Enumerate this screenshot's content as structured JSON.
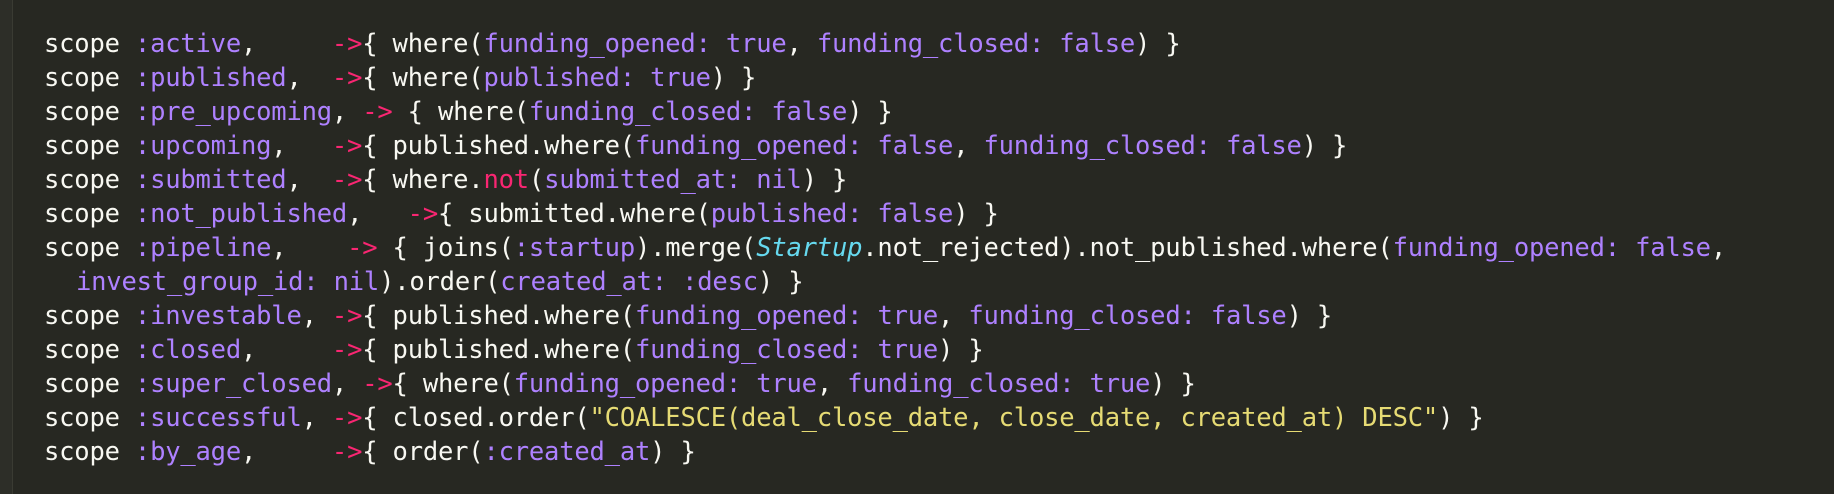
{
  "editor": {
    "colors": {
      "background": "#272822",
      "plain": "#f8f8f2",
      "symbol": "#ae81ff",
      "arrow": "#f92672",
      "class": "#66d9ef",
      "string": "#e6db74"
    },
    "lines": [
      [
        {
          "t": "kw",
          "v": "scope "
        },
        {
          "t": "sym",
          "v": ":active"
        },
        {
          "t": "pl",
          "v": ",     "
        },
        {
          "t": "arr",
          "v": "->"
        },
        {
          "t": "pl",
          "v": "{ where("
        },
        {
          "t": "key",
          "v": "funding_opened:"
        },
        {
          "t": "pl",
          "v": " "
        },
        {
          "t": "bool",
          "v": "true"
        },
        {
          "t": "pl",
          "v": ", "
        },
        {
          "t": "key",
          "v": "funding_closed:"
        },
        {
          "t": "pl",
          "v": " "
        },
        {
          "t": "bool",
          "v": "false"
        },
        {
          "t": "pl",
          "v": ") }"
        }
      ],
      [
        {
          "t": "kw",
          "v": "scope "
        },
        {
          "t": "sym",
          "v": ":published"
        },
        {
          "t": "pl",
          "v": ",  "
        },
        {
          "t": "arr",
          "v": "->"
        },
        {
          "t": "pl",
          "v": "{ where("
        },
        {
          "t": "key",
          "v": "published:"
        },
        {
          "t": "pl",
          "v": " "
        },
        {
          "t": "bool",
          "v": "true"
        },
        {
          "t": "pl",
          "v": ") }"
        }
      ],
      [
        {
          "t": "kw",
          "v": "scope "
        },
        {
          "t": "sym",
          "v": ":pre_upcoming"
        },
        {
          "t": "pl",
          "v": ", "
        },
        {
          "t": "arr",
          "v": "->"
        },
        {
          "t": "pl",
          "v": " { where("
        },
        {
          "t": "key",
          "v": "funding_closed:"
        },
        {
          "t": "pl",
          "v": " "
        },
        {
          "t": "bool",
          "v": "false"
        },
        {
          "t": "pl",
          "v": ") }"
        }
      ],
      [
        {
          "t": "kw",
          "v": "scope "
        },
        {
          "t": "sym",
          "v": ":upcoming"
        },
        {
          "t": "pl",
          "v": ",   "
        },
        {
          "t": "arr",
          "v": "->"
        },
        {
          "t": "pl",
          "v": "{ published.where("
        },
        {
          "t": "key",
          "v": "funding_opened:"
        },
        {
          "t": "pl",
          "v": " "
        },
        {
          "t": "bool",
          "v": "false"
        },
        {
          "t": "pl",
          "v": ", "
        },
        {
          "t": "key",
          "v": "funding_closed:"
        },
        {
          "t": "pl",
          "v": " "
        },
        {
          "t": "bool",
          "v": "false"
        },
        {
          "t": "pl",
          "v": ") }"
        }
      ],
      [
        {
          "t": "kw",
          "v": "scope "
        },
        {
          "t": "sym",
          "v": ":submitted"
        },
        {
          "t": "pl",
          "v": ",  "
        },
        {
          "t": "arr",
          "v": "->"
        },
        {
          "t": "pl",
          "v": "{ where."
        },
        {
          "t": "not",
          "v": "not"
        },
        {
          "t": "pl",
          "v": "("
        },
        {
          "t": "key",
          "v": "submitted_at:"
        },
        {
          "t": "pl",
          "v": " "
        },
        {
          "t": "bool",
          "v": "nil"
        },
        {
          "t": "pl",
          "v": ") }"
        }
      ],
      [
        {
          "t": "kw",
          "v": "scope "
        },
        {
          "t": "sym",
          "v": ":not_published"
        },
        {
          "t": "pl",
          "v": ",   "
        },
        {
          "t": "arr",
          "v": "->"
        },
        {
          "t": "pl",
          "v": "{ submitted.where("
        },
        {
          "t": "key",
          "v": "published:"
        },
        {
          "t": "pl",
          "v": " "
        },
        {
          "t": "bool",
          "v": "false"
        },
        {
          "t": "pl",
          "v": ") }"
        }
      ],
      [
        {
          "t": "kw",
          "v": "scope "
        },
        {
          "t": "sym",
          "v": ":pipeline"
        },
        {
          "t": "pl",
          "v": ",    "
        },
        {
          "t": "arr",
          "v": "->"
        },
        {
          "t": "pl",
          "v": " { joins("
        },
        {
          "t": "sym",
          "v": ":startup"
        },
        {
          "t": "pl",
          "v": ").merge("
        },
        {
          "t": "cls",
          "v": "Startup"
        },
        {
          "t": "pl",
          "v": ".not_rejected).not_published.where("
        },
        {
          "t": "key",
          "v": "funding_opened:"
        },
        {
          "t": "pl",
          "v": " "
        },
        {
          "t": "bool",
          "v": "false"
        },
        {
          "t": "pl",
          "v": ","
        }
      ],
      [
        {
          "t": "key",
          "v": "invest_group_id:"
        },
        {
          "t": "pl",
          "v": " "
        },
        {
          "t": "bool",
          "v": "nil"
        },
        {
          "t": "pl",
          "v": ").order("
        },
        {
          "t": "key",
          "v": "created_at:"
        },
        {
          "t": "pl",
          "v": " "
        },
        {
          "t": "sym",
          "v": ":desc"
        },
        {
          "t": "pl",
          "v": ") }"
        }
      ],
      [
        {
          "t": "kw",
          "v": "scope "
        },
        {
          "t": "sym",
          "v": ":investable"
        },
        {
          "t": "pl",
          "v": ", "
        },
        {
          "t": "arr",
          "v": "->"
        },
        {
          "t": "pl",
          "v": "{ published.where("
        },
        {
          "t": "key",
          "v": "funding_opened:"
        },
        {
          "t": "pl",
          "v": " "
        },
        {
          "t": "bool",
          "v": "true"
        },
        {
          "t": "pl",
          "v": ", "
        },
        {
          "t": "key",
          "v": "funding_closed:"
        },
        {
          "t": "pl",
          "v": " "
        },
        {
          "t": "bool",
          "v": "false"
        },
        {
          "t": "pl",
          "v": ") }"
        }
      ],
      [
        {
          "t": "kw",
          "v": "scope "
        },
        {
          "t": "sym",
          "v": ":closed"
        },
        {
          "t": "pl",
          "v": ",     "
        },
        {
          "t": "arr",
          "v": "->"
        },
        {
          "t": "pl",
          "v": "{ published.where("
        },
        {
          "t": "key",
          "v": "funding_closed:"
        },
        {
          "t": "pl",
          "v": " "
        },
        {
          "t": "bool",
          "v": "true"
        },
        {
          "t": "pl",
          "v": ") }"
        }
      ],
      [
        {
          "t": "kw",
          "v": "scope "
        },
        {
          "t": "sym",
          "v": ":super_closed"
        },
        {
          "t": "pl",
          "v": ", "
        },
        {
          "t": "arr",
          "v": "->"
        },
        {
          "t": "pl",
          "v": "{ where("
        },
        {
          "t": "key",
          "v": "funding_opened:"
        },
        {
          "t": "pl",
          "v": " "
        },
        {
          "t": "bool",
          "v": "true"
        },
        {
          "t": "pl",
          "v": ", "
        },
        {
          "t": "key",
          "v": "funding_closed:"
        },
        {
          "t": "pl",
          "v": " "
        },
        {
          "t": "bool",
          "v": "true"
        },
        {
          "t": "pl",
          "v": ") }"
        }
      ],
      [
        {
          "t": "kw",
          "v": "scope "
        },
        {
          "t": "sym",
          "v": ":successful"
        },
        {
          "t": "pl",
          "v": ", "
        },
        {
          "t": "arr",
          "v": "->"
        },
        {
          "t": "pl",
          "v": "{ closed.order("
        },
        {
          "t": "str",
          "v": "\"COALESCE(deal_close_date, close_date, created_at) DESC\""
        },
        {
          "t": "pl",
          "v": ") }"
        }
      ],
      [
        {
          "t": "kw",
          "v": "scope "
        },
        {
          "t": "sym",
          "v": ":by_age"
        },
        {
          "t": "pl",
          "v": ",     "
        },
        {
          "t": "arr",
          "v": "->"
        },
        {
          "t": "pl",
          "v": "{ order("
        },
        {
          "t": "sym",
          "v": ":created_at"
        },
        {
          "t": "pl",
          "v": ") }"
        }
      ]
    ]
  }
}
